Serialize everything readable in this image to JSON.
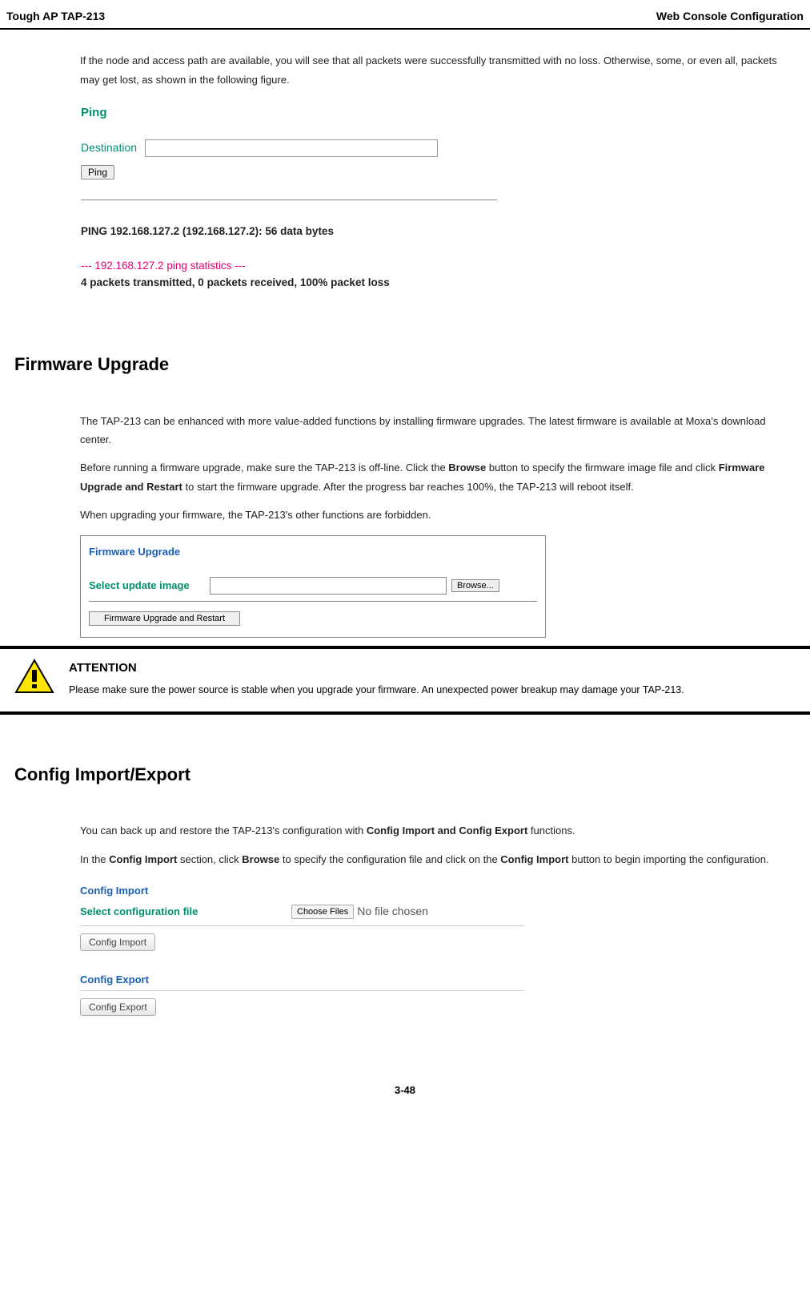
{
  "header": {
    "left": "Tough AP TAP-213",
    "right": "Web Console Configuration"
  },
  "intro_para": "If the node and access path are available, you will see that all packets were successfully transmitted with no loss. Otherwise, some, or even all, packets may get lost, as shown in the following figure.",
  "ping": {
    "title": "Ping",
    "dest_label": "Destination",
    "btn": "Ping",
    "out_line1": "PING 192.168.127.2 (192.168.127.2): 56 data bytes",
    "out_line2": "--- 192.168.127.2 ping statistics ---",
    "out_line3": "4 packets transmitted, 0 packets received, 100% packet loss"
  },
  "fw": {
    "heading": "Firmware Upgrade",
    "para1": "The TAP-213 can be enhanced with more value-added functions by installing firmware upgrades. The latest firmware is available at Moxa's download center.",
    "para2_a": "Before running a firmware upgrade, make sure the TAP-213 is off-line. Click the ",
    "para2_b": "Browse",
    "para2_c": " button to specify the firmware image file and click ",
    "para2_d": "Firmware Upgrade and Restart",
    "para2_e": " to start the firmware upgrade. After the progress bar reaches 100%, the TAP-213 will reboot itself.",
    "para3": "When upgrading your firmware, the TAP-213's other functions are forbidden.",
    "shot_title": "Firmware Upgrade",
    "shot_label": "Select update image",
    "browse": "Browse...",
    "submit": "Firmware Upgrade and Restart"
  },
  "attention": {
    "title": "ATTENTION",
    "body": "Please make sure the power source is stable when you upgrade your firmware. An unexpected power breakup may damage your TAP-213."
  },
  "cfg": {
    "heading": "Config Import/Export",
    "para1_a": "You can back up and restore the TAP-213's configuration with ",
    "para1_b": "Config Import and Config Export",
    "para1_c": " functions.",
    "para2_a": "In the ",
    "para2_b": "Config Import",
    "para2_c": " section, click ",
    "para2_d": "Browse",
    "para2_e": " to specify the configuration file and click on the ",
    "para2_f": "Config Import",
    "para2_g": " button to begin importing the configuration.",
    "import_title": "Config Import",
    "import_label": "Select configuration file",
    "choose": "Choose Files",
    "nochosen": "No file chosen",
    "import_btn": "Config Import",
    "export_title": "Config Export",
    "export_btn": "Config Export"
  },
  "footer": "3-48"
}
